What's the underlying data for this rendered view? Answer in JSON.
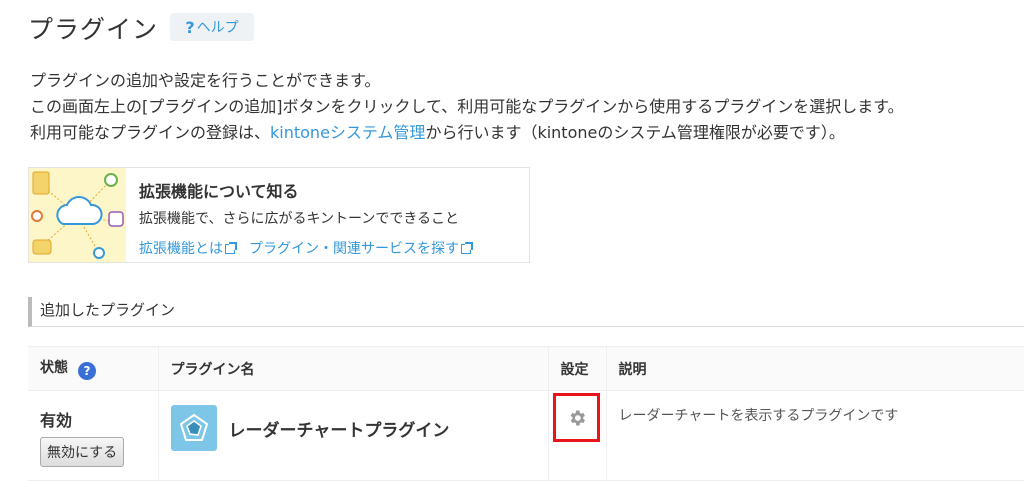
{
  "page": {
    "title": "プラグイン",
    "help_label": "ヘルプ",
    "help_mark": "?"
  },
  "description": {
    "line1": "プラグインの追加や設定を行うことができます。",
    "line2": "この画面左上の[プラグインの追加]ボタンをクリックして、利用可能なプラグインから使用するプラグインを選択します。",
    "line3_prefix": "利用可能なプラグインの登録は、",
    "line3_link": "kintoneシステム管理",
    "line3_suffix": "から行います（kintoneのシステム管理権限が必要です）。"
  },
  "extension_card": {
    "title": "拡張機能について知る",
    "subtitle": "拡張機能で、さらに広がるキントーンでできること",
    "link1": "拡張機能とは",
    "link2": "プラグイン・関連サービスを探す"
  },
  "section_title": "追加したプラグイン",
  "table": {
    "headers": {
      "status": "状態",
      "name": "プラグイン名",
      "settings": "設定",
      "description": "説明"
    },
    "help_mark": "?",
    "rows": [
      {
        "status": "有効",
        "disable_button": "無効にする",
        "name": "レーダーチャートプラグイン",
        "description": "レーダーチャートを表示するプラグインです"
      }
    ]
  },
  "colors": {
    "link": "#3498db",
    "highlight": "#e8141a",
    "plugin_icon_bg": "#7ec6e8"
  },
  "icons": [
    "help-icon",
    "external-link-icon",
    "question-circle-icon",
    "radar-chart-icon",
    "gear-icon"
  ]
}
